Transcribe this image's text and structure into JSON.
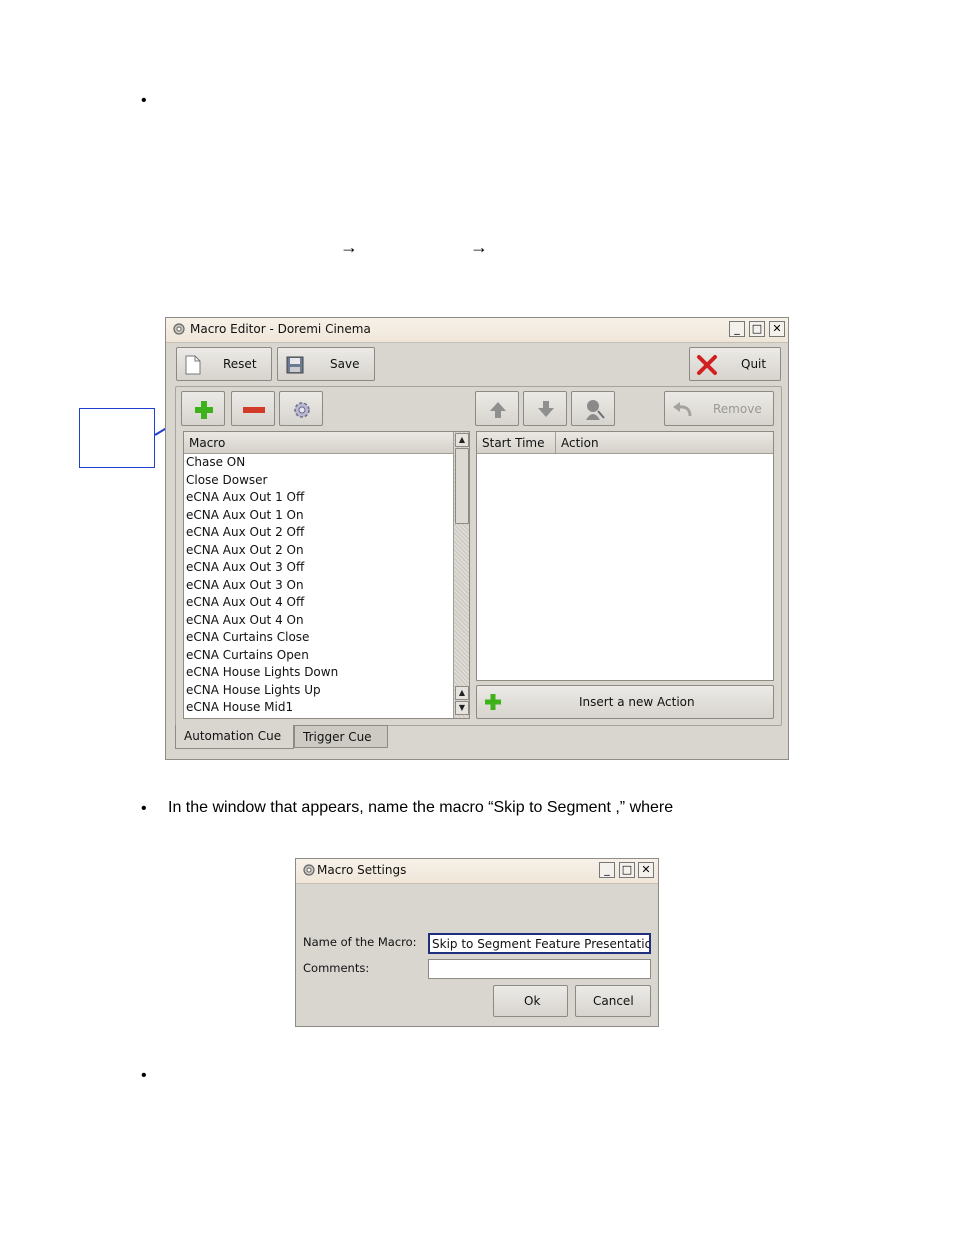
{
  "document": {
    "bullet": "•",
    "arrow": "→",
    "step2_text": "In the window that appears, name the macro “Skip to Segment ,” where"
  },
  "macro_editor": {
    "title": "Macro Editor - Doremi Cinema",
    "toolbar": {
      "reset_label": "Reset",
      "save_label": "Save",
      "quit_label": "Quit"
    },
    "actions_toolbar": {
      "remove_label": "Remove"
    },
    "macro_list": {
      "header": "Macro",
      "items": [
        "Chase ON",
        "Close Dowser",
        "eCNA Aux Out 1 Off",
        "eCNA Aux Out 1 On",
        "eCNA Aux Out 2 Off",
        "eCNA Aux Out 2 On",
        "eCNA Aux Out 3 Off",
        "eCNA Aux Out 3 On",
        "eCNA Aux Out 4 Off",
        "eCNA Aux Out 4 On",
        "eCNA Curtains Close",
        "eCNA Curtains Open",
        "eCNA House Lights Down",
        "eCNA House Lights Up",
        "eCNA House Mid1"
      ]
    },
    "action_list": {
      "headers": [
        "Start Time",
        "Action"
      ]
    },
    "insert_action_label": "Insert a new Action",
    "tabs": [
      "Automation Cue",
      "Trigger Cue"
    ],
    "colors": {
      "add": "#3fb21b",
      "remove": "#d33a2a",
      "quit_x": "#d21f1f",
      "callout": "#1f3fd0"
    }
  },
  "macro_settings": {
    "title": "Macro Settings",
    "name_label": "Name of the Macro:",
    "name_value": "Skip to Segment Feature Presentation",
    "comments_label": "Comments:",
    "comments_value": "",
    "ok_label": "Ok",
    "cancel_label": "Cancel"
  }
}
